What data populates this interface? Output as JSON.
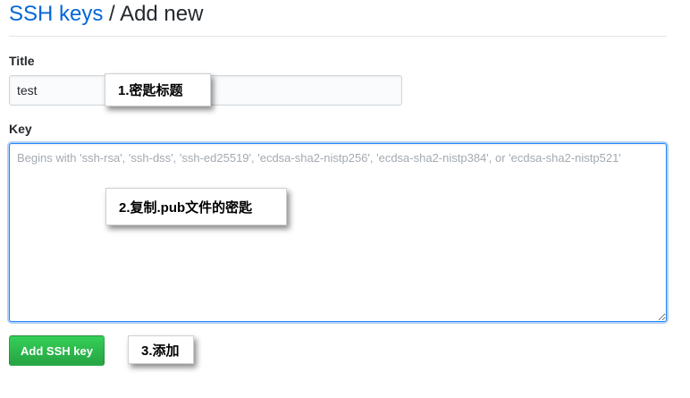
{
  "breadcrumb": {
    "parent_label": "SSH keys",
    "separator": " / ",
    "current_label": "Add new"
  },
  "form": {
    "title_label": "Title",
    "title_value": "test",
    "key_label": "Key",
    "key_placeholder": "Begins with 'ssh-rsa', 'ssh-dss', 'ssh-ed25519', 'ecdsa-sha2-nistp256', 'ecdsa-sha2-nistp384', or 'ecdsa-sha2-nistp521'",
    "submit_label": "Add SSH key"
  },
  "annotations": {
    "title_note": "1.密匙标题",
    "key_note": "2.复制.pub文件的密匙",
    "submit_note": "3.添加"
  },
  "colors": {
    "link": "#0366d6",
    "button": "#28a745",
    "focus_border": "#2188ff"
  }
}
